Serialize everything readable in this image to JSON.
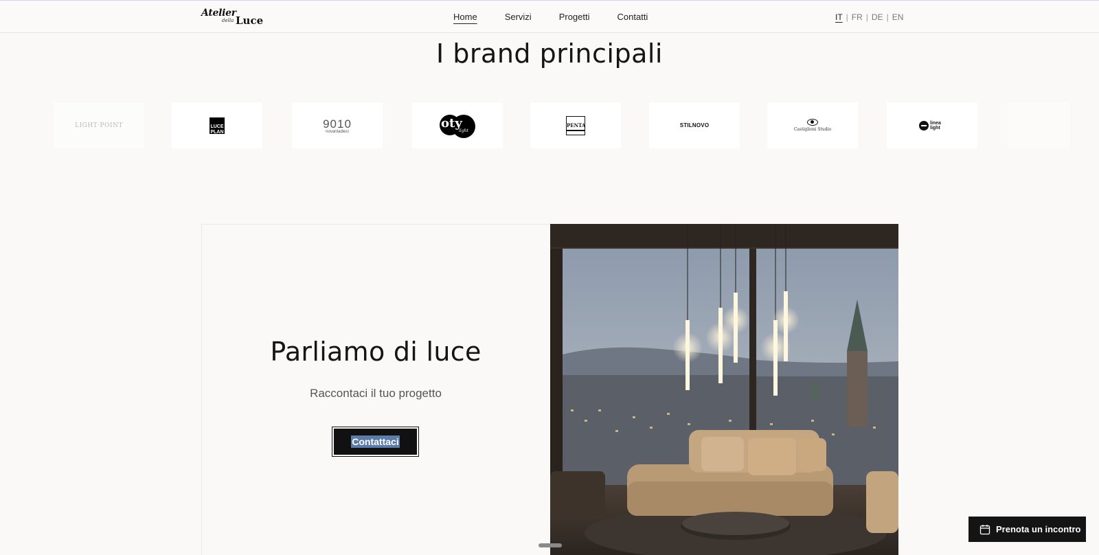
{
  "header": {
    "logo": {
      "line1": "Atelier",
      "line2": "della",
      "line3": "Luce"
    },
    "nav": [
      "Home",
      "Servizi",
      "Progetti",
      "Contatti"
    ],
    "active_nav": "Home",
    "languages": [
      "IT",
      "FR",
      "DE",
      "EN"
    ],
    "active_language": "IT"
  },
  "brands": {
    "title": "I brand principali",
    "items": [
      {
        "name": "LIGHT·POINT"
      },
      {
        "name": "LUCE PLAN"
      },
      {
        "name": "9010",
        "sub": "novantadieci"
      },
      {
        "name": "oty",
        "sub": "light"
      },
      {
        "name": "PENTA"
      },
      {
        "name": "STILNOVO"
      },
      {
        "name": "Castiglioni Studio"
      },
      {
        "name": "linea light"
      },
      {
        "name": ""
      }
    ]
  },
  "cta": {
    "title": "Parliamo di luce",
    "subtitle": "Raccontaci il tuo progetto",
    "button": "Contattaci"
  },
  "floating": {
    "book_button": "Prenota un incontro"
  },
  "colors": {
    "background": "#faf9f7",
    "text": "#151515",
    "button_bg": "#111111",
    "selection": "#5b7ba8"
  }
}
